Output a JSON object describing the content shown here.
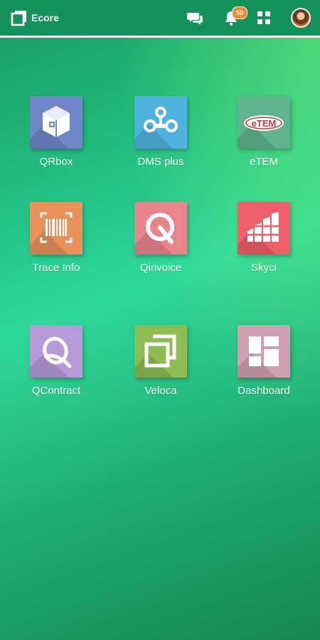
{
  "header": {
    "app_name": "Ecore",
    "notification_count": "50",
    "icons": [
      "logo-icon",
      "chat-icon",
      "bell-icon",
      "grid-icon",
      "avatar"
    ]
  },
  "apps": [
    {
      "label": "QRbox",
      "color": "#6f86c9",
      "icon": "box-icon"
    },
    {
      "label": "DMS plus",
      "color": "#4fb3e0",
      "icon": "nodes-icon"
    },
    {
      "label": "eTEM",
      "color": "#5fb38e",
      "icon": "etem-logo-icon"
    },
    {
      "label": "Trace Info",
      "color": "#e8925a",
      "icon": "barcode-icon"
    },
    {
      "label": "Qinvoice",
      "color": "#e8858c",
      "icon": "q-icon"
    },
    {
      "label": "Skyci",
      "color": "#ee5f6a",
      "icon": "skyci-icon"
    },
    {
      "label": "QContract",
      "color": "#b49ad6",
      "icon": "q-contract-icon"
    },
    {
      "label": "Veloca",
      "color": "#8fbc52",
      "icon": "veloca-icon"
    },
    {
      "label": "Dashboard",
      "color": "#cf9fb2",
      "icon": "dashboard-icon"
    }
  ],
  "etem_logo_text": "eTEM"
}
